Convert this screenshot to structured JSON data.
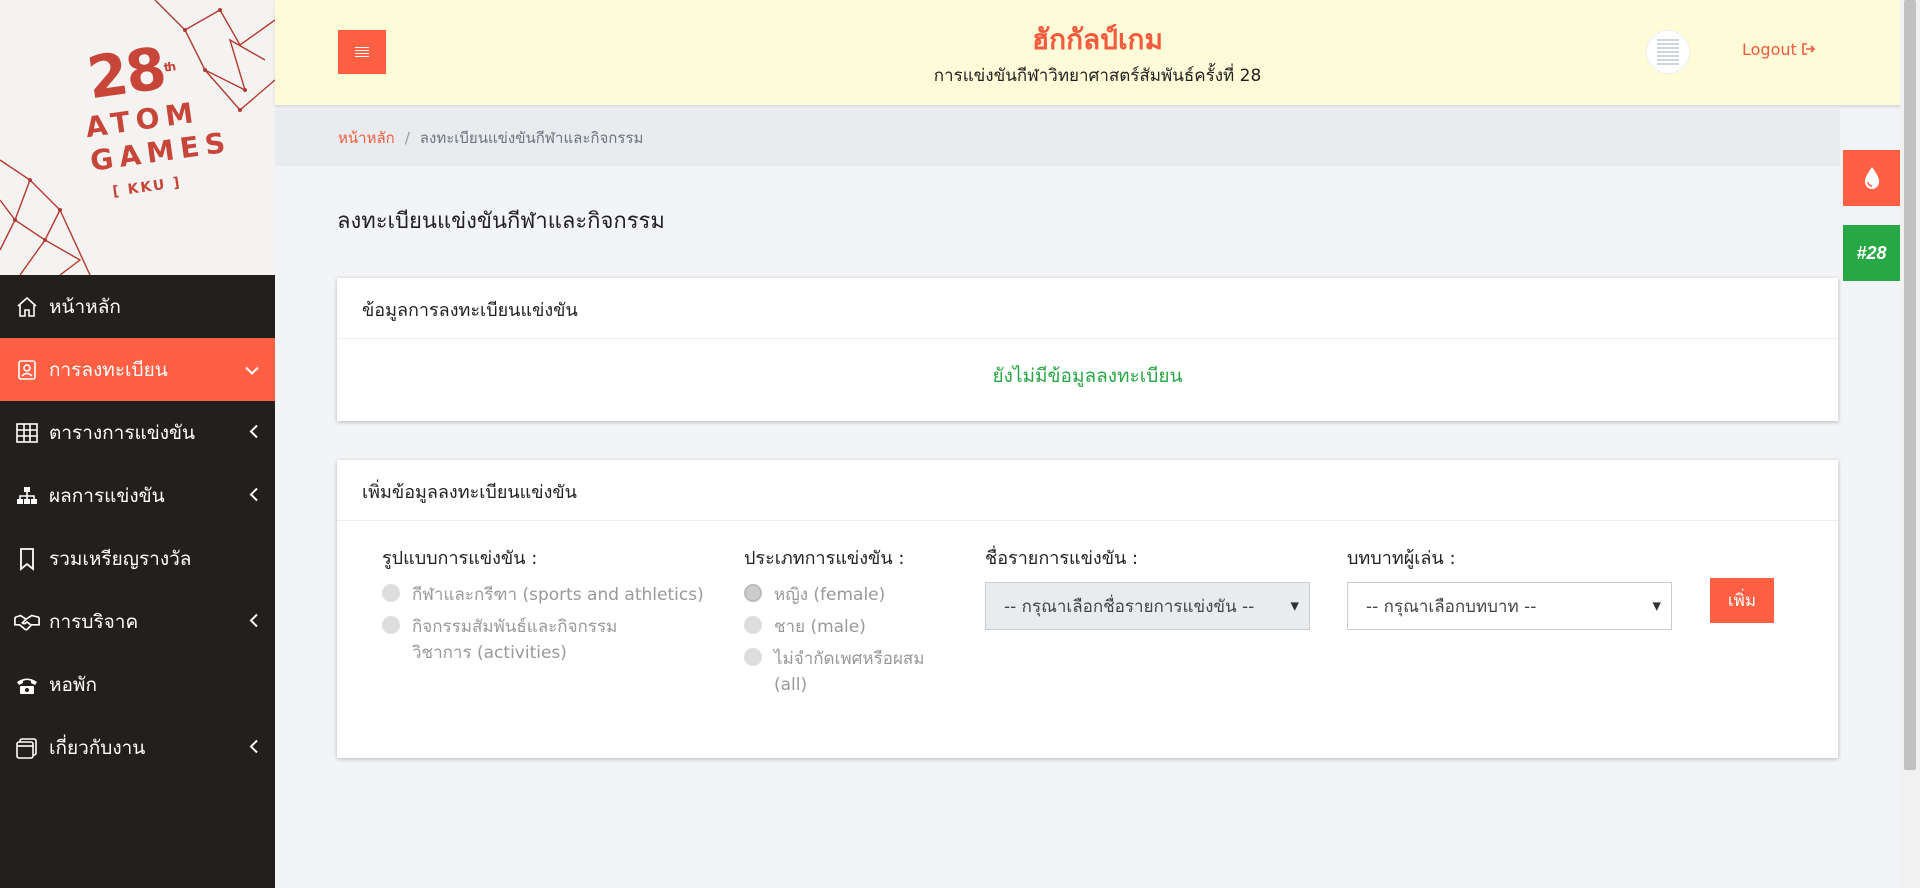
{
  "sidebar": {
    "logo": {
      "number": "28",
      "suffix": "th",
      "word1": "ATOM",
      "word2": "GAMES",
      "sub": "[ KKU ]"
    },
    "items": [
      {
        "label": "หน้าหลัก",
        "icon": "home-icon",
        "has_chevron": false,
        "chevron": ""
      },
      {
        "label": "การลงทะเบียน",
        "icon": "register-icon",
        "has_chevron": true,
        "chevron": "⌄"
      },
      {
        "label": "ตารางการแข่งขัน",
        "icon": "table-grid-icon",
        "has_chevron": true,
        "chevron": "‹"
      },
      {
        "label": "ผลการแข่งขัน",
        "icon": "sitemap-icon",
        "has_chevron": true,
        "chevron": "‹"
      },
      {
        "label": "รวมเหรียญรางวัล",
        "icon": "bookmark-icon",
        "has_chevron": false,
        "chevron": ""
      },
      {
        "label": "การบริจาค",
        "icon": "handshake-icon",
        "has_chevron": true,
        "chevron": "‹"
      },
      {
        "label": "หอพัก",
        "icon": "phone-icon",
        "has_chevron": false,
        "chevron": ""
      },
      {
        "label": "เกี่ยวกับงาน",
        "icon": "window-icon",
        "has_chevron": true,
        "chevron": "‹"
      }
    ]
  },
  "header": {
    "title": "ฮักกัลป์เกม",
    "subtitle": "การแข่งขันกีฬาวิทยาศาสตร์สัมพันธ์ครั้งที่ 28",
    "logout_label": "Logout"
  },
  "breadcrumb": {
    "home": "หน้าหลัก",
    "separator": "/",
    "current": "ลงทะเบียนแข่งขันกีฬาและกิจกรรม"
  },
  "page_title": "ลงทะเบียนแข่งขันกีฬาและกิจกรรม",
  "card_info": {
    "heading": "ข้อมูลการลงทะเบียนแข่งขัน",
    "empty_message": "ยังไม่มีข้อมูลลงทะเบียน"
  },
  "card_add": {
    "heading": "เพิ่มข้อมูลลงทะเบียนแข่งขัน",
    "format": {
      "label": "รูปแบบการแข่งขัน :",
      "options": [
        "กีฬาและกรีฑา (sports and athletics)",
        "กิจกรรมสัมพันธ์และกิจกรรมวิชาการ (activities)"
      ]
    },
    "type": {
      "label": "ประเภทการแข่งขัน :",
      "options": [
        "หญิง (female)",
        "ชาย (male)",
        "ไม่จำกัดเพศหรือผสม (all)"
      ]
    },
    "event_name": {
      "label": "ชื่อรายการแข่งขัน :",
      "value": "-- กรุณาเลือกชื่อรายการแข่งขัน --"
    },
    "role": {
      "label": "บทบาทผู้เล่น :",
      "value": "-- กรุณาเลือกบทบาท --"
    },
    "add_button": "เพิ่ม"
  },
  "floating": {
    "badge_label": "#28"
  },
  "colors": {
    "accent": "#ff5f43",
    "header_bg": "#fefbd8",
    "sidebar_bg": "#231f1c",
    "success": "#28a745"
  }
}
